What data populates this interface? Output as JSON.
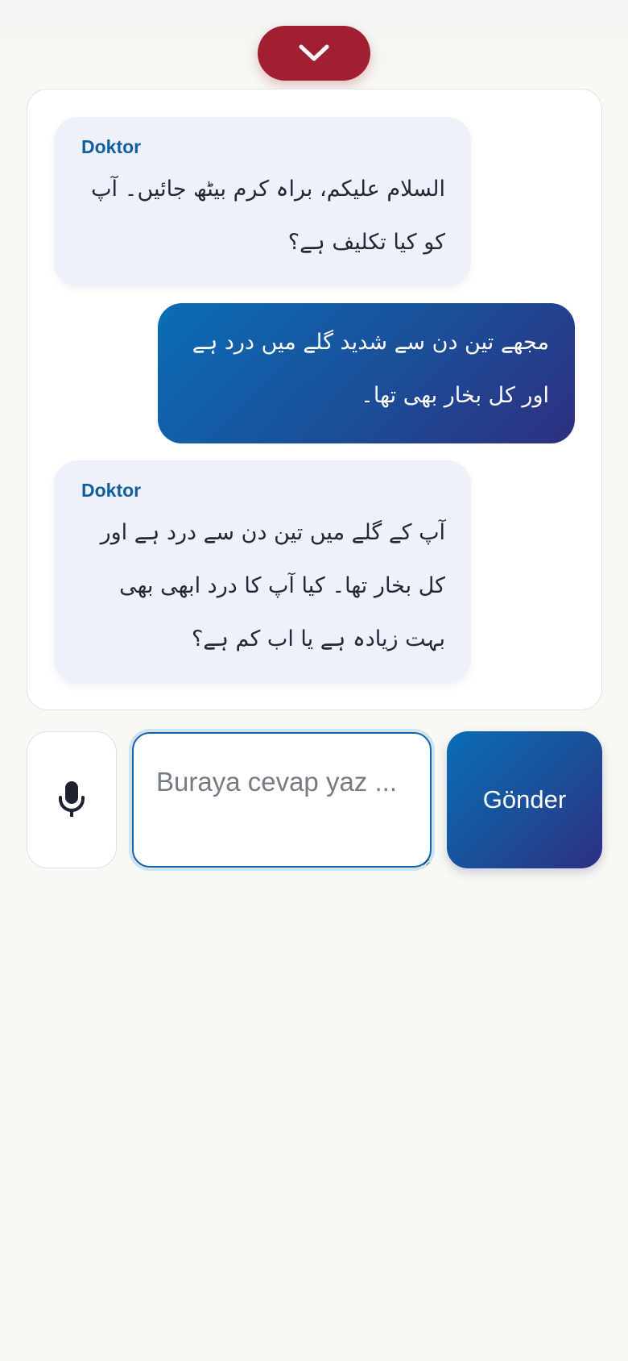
{
  "header": {
    "collapse_icon": "chevron-down-icon",
    "collapse_color": "#a01f33"
  },
  "chat": {
    "messages": [
      {
        "role": "doctor",
        "sender": "Doktor",
        "text": "السلام علیکم، براہ کرم بیٹھ جائیں۔ آپ کو کیا تکلیف ہے؟"
      },
      {
        "role": "user",
        "text": "مجھے تین دن سے شدید گلے میں درد ہے اور کل بخار بھی تھا۔"
      },
      {
        "role": "doctor",
        "sender": "Doktor",
        "text": "آپ کے گلے میں تین دن سے درد ہے اور کل بخار تھا۔ کیا آپ کا درد ابھی بھی بہت زیادہ ہے یا اب کم ہے؟"
      }
    ]
  },
  "composer": {
    "mic_icon": "microphone-icon",
    "placeholder": "Buraya cevap yaz ...",
    "value": "",
    "send_label": "Gönder"
  },
  "colors": {
    "accent": "#1463a8",
    "doctor_bubble": "#eef0fa",
    "user_bubble_start": "#0a6db5",
    "user_bubble_end": "#2e2f80"
  }
}
